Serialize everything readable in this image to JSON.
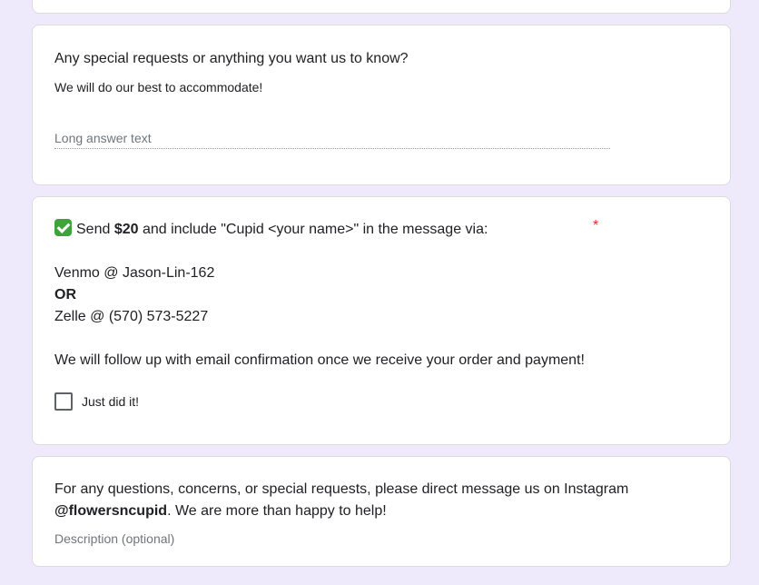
{
  "requests_question": {
    "title": "Any special requests or anything you want us to know?",
    "description": "We will do our best to accommodate!",
    "answer_placeholder": "Long answer text"
  },
  "payment_question": {
    "emoji": "check-mark-button-icon",
    "line1_pre": "Send ",
    "line1_amount": "$20",
    "line1_post": " and include \"Cupid <your name>\" in the message via:",
    "venmo": "Venmo @ Jason-Lin-162",
    "or_label": "OR",
    "zelle": "Zelle @ (570) 573-5227",
    "followup": "We will follow up with email confirmation once we receive your order and payment!",
    "required_mark": "*",
    "checkbox_label": "Just did it!",
    "checkbox_checked": false
  },
  "contact_section": {
    "text_pre": "For any questions, concerns, or special requests, please direct message us on Instagram ",
    "instagram_handle": "@flowersncupid",
    "text_post": ". We are more than happy to help!",
    "optional_label": "Description (optional)"
  },
  "colors": {
    "page_background": "#eeeafb",
    "required": "#d93025",
    "check_emoji": "#3fa33b"
  }
}
